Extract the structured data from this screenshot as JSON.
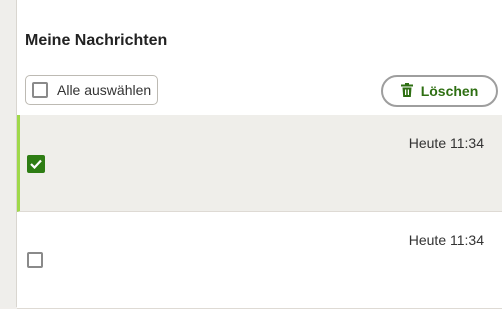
{
  "page": {
    "title": "Meine Nachrichten"
  },
  "toolbar": {
    "select_all_label": "Alle auswählen",
    "delete_label": "Löschen"
  },
  "colors": {
    "accent_green": "#2e7d14",
    "selected_row_bar": "#9fd84a"
  },
  "messages": [
    {
      "time": "Heute 11:34",
      "checked": true
    },
    {
      "time": "Heute 11:34",
      "checked": false
    }
  ]
}
